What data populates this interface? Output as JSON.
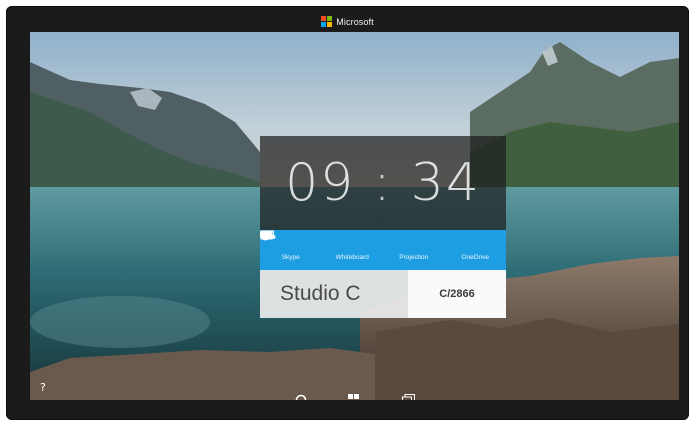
{
  "brand": {
    "name": "Microsoft",
    "logo_colors": [
      "#f25022",
      "#7fba00",
      "#00a4ef",
      "#ffb900"
    ]
  },
  "clock": {
    "hours": "09",
    "separator": ":",
    "minutes": "34"
  },
  "apps": [
    {
      "label": "Skype",
      "icon": "skype-icon"
    },
    {
      "label": "Whiteboard",
      "icon": "whiteboard-icon"
    },
    {
      "label": "Projection",
      "icon": "projection-icon"
    },
    {
      "label": "OneDrive",
      "icon": "onedrive-icon"
    }
  ],
  "room": {
    "name": "Studio C",
    "code": "C/2866"
  },
  "taskbar": {
    "help": "?",
    "icons": [
      "help-icon",
      "cortana-icon",
      "windows-start-icon",
      "task-view-icon"
    ]
  },
  "colors": {
    "app_bar": "#1d9ee3",
    "bezel": "#1b1b1b"
  }
}
